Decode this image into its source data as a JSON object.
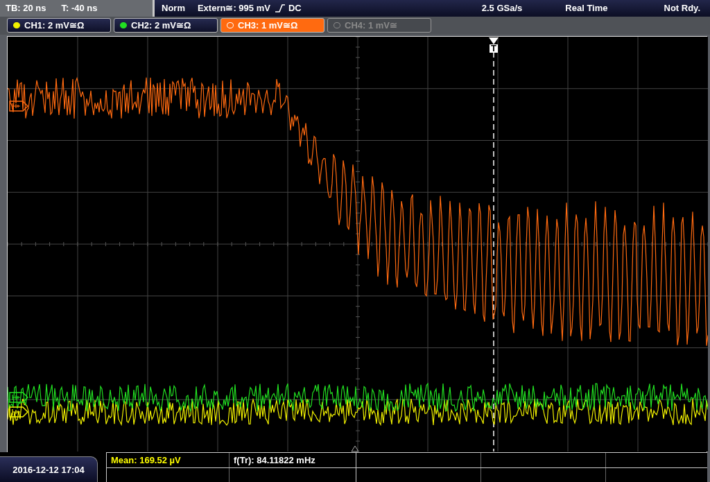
{
  "status": {
    "timebase": "TB: 20 ns",
    "trigger_time": "T: -40 ns",
    "mode": "Norm",
    "trigger_level": "Extern≅: 995 mV",
    "coupling": "DC",
    "sample_rate": "2.5 GSa/s",
    "acquisition": "Real Time",
    "state": "Not Rdy."
  },
  "channels": [
    {
      "label": "CH1: 2 mV≅Ω",
      "color": "#f2f200",
      "selected": false,
      "enabled": true
    },
    {
      "label": "CH2: 2 mV≅Ω",
      "color": "#22e022",
      "selected": false,
      "enabled": true
    },
    {
      "label": "CH3: 1 mV≅Ω",
      "color": "#ff6a10",
      "selected": true,
      "enabled": true
    },
    {
      "label": "CH4: 1 mV≅",
      "color": "#888888",
      "selected": false,
      "enabled": false
    }
  ],
  "trigger_marker": "T",
  "measurements": [
    {
      "text": "Mean: 169.52 µV",
      "color": "#ffff00"
    },
    {
      "text": "f(Tr): 84.11822 mHz",
      "color": "#ffffff"
    }
  ],
  "date": "2016-12-12 17:04"
}
